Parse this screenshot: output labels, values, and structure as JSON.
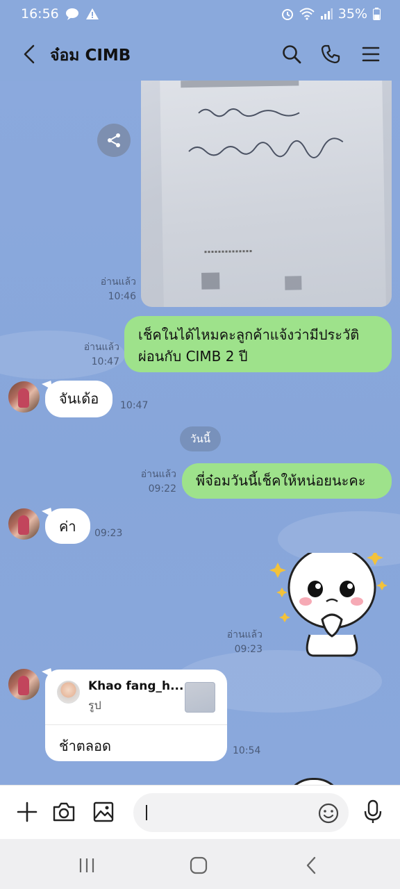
{
  "status_bar": {
    "time": "16:56",
    "battery": "35%",
    "icons": [
      "chat-bubble-icon",
      "warning-icon",
      "alarm-icon",
      "wifi-icon",
      "signal-icon",
      "battery-icon"
    ]
  },
  "header": {
    "title": "จ๋อม CIMB",
    "icons": [
      "back-arrow-icon",
      "search-icon",
      "phone-icon",
      "menu-icon"
    ]
  },
  "messages": {
    "photo": {
      "read": "อ่านแล้ว",
      "time": "10:46"
    },
    "out1": {
      "read": "อ่านแล้ว",
      "time": "10:47",
      "line1": "เช็คในได้ไหมคะลูกค้าแจ้งว่ามีประวัติ",
      "line2": "ผ่อนกับ CIMB 2 ปี"
    },
    "in1": {
      "text": "จันเด้อ",
      "time": "10:47"
    },
    "date_chip": "วันนี้",
    "out2": {
      "read": "อ่านแล้ว",
      "time": "09:22",
      "text": "พี่จ๋อมวันนี้เช็คให้หน่อยนะคะ"
    },
    "in2": {
      "text": "ค่า",
      "time": "09:23"
    },
    "sticker": {
      "read": "อ่านแล้ว",
      "time": "09:23"
    },
    "shared": {
      "name": "Khao fang_h...",
      "sub": "รูป",
      "message": "ช้าตลอด",
      "time": "10:54"
    }
  },
  "input_bar": {
    "icons": [
      "plus-icon",
      "camera-icon",
      "image-icon",
      "emoji-icon",
      "microphone-icon"
    ],
    "value": ""
  },
  "nav_bar": {
    "icons": [
      "recents-icon",
      "home-icon",
      "back-icon"
    ]
  },
  "colors": {
    "background": "#8aa9dc",
    "outgoing_bubble": "#9ee28b",
    "incoming_bubble": "#ffffff",
    "date_chip": "#7891bb"
  }
}
